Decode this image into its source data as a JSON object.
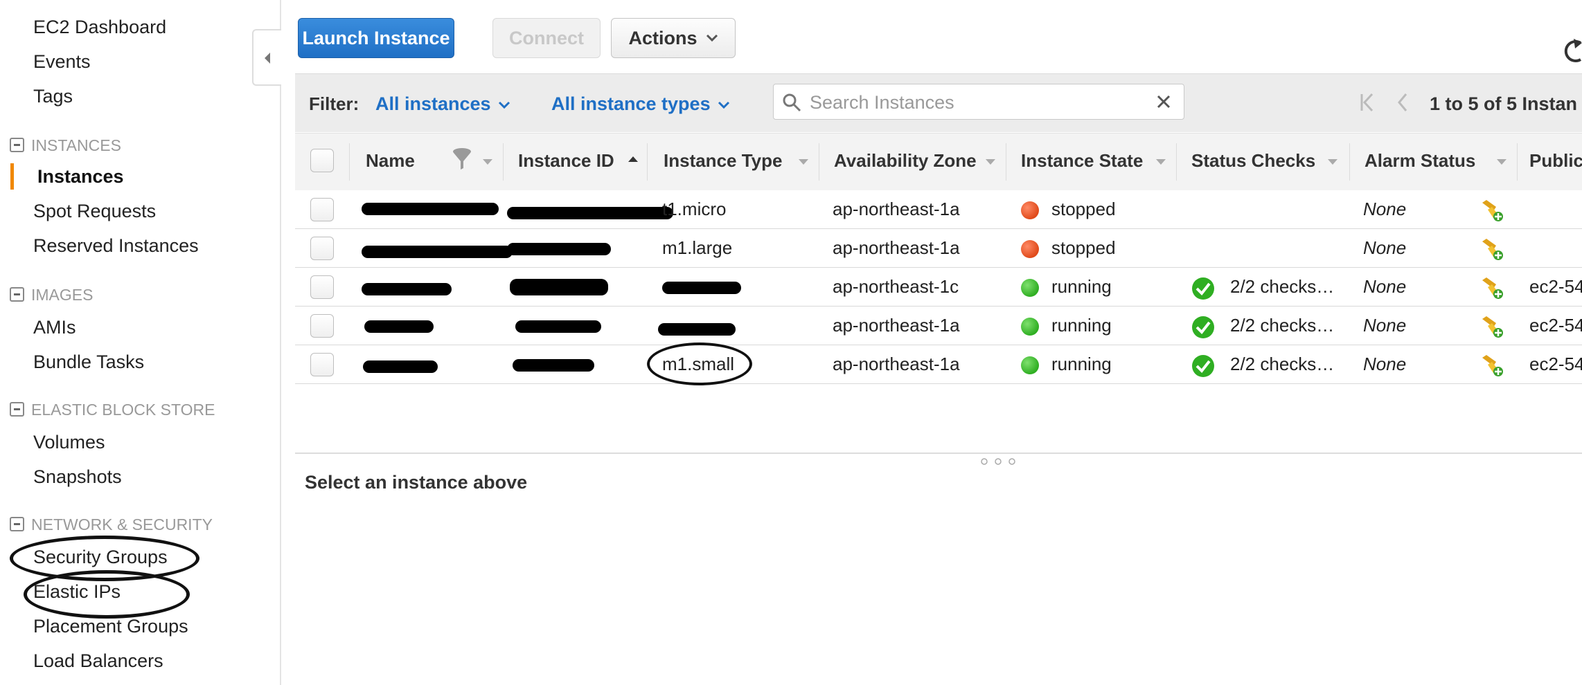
{
  "sidebar": {
    "top_items": [
      {
        "label": "EC2 Dashboard"
      },
      {
        "label": "Events"
      },
      {
        "label": "Tags"
      }
    ],
    "sections": [
      {
        "title": "INSTANCES",
        "items": [
          {
            "label": "Instances",
            "active": true
          },
          {
            "label": "Spot Requests"
          },
          {
            "label": "Reserved Instances"
          }
        ]
      },
      {
        "title": "IMAGES",
        "items": [
          {
            "label": "AMIs"
          },
          {
            "label": "Bundle Tasks"
          }
        ]
      },
      {
        "title": "ELASTIC BLOCK STORE",
        "items": [
          {
            "label": "Volumes"
          },
          {
            "label": "Snapshots"
          }
        ]
      },
      {
        "title": "NETWORK & SECURITY",
        "items": [
          {
            "label": "Security Groups",
            "circled": true
          },
          {
            "label": "Elastic IPs",
            "circled": true
          },
          {
            "label": "Placement Groups"
          },
          {
            "label": "Load Balancers"
          }
        ]
      }
    ],
    "accent_color": "#f08804"
  },
  "toolbar": {
    "launch_label": "Launch Instance",
    "connect_label": "Connect",
    "actions_label": "Actions",
    "primary_color": "#1f6fc5"
  },
  "filter": {
    "label": "Filter:",
    "instances_dropdown": "All instances",
    "types_dropdown": "All instance types",
    "search_placeholder": "Search Instances",
    "pager_text": "1 to 5 of 5 Instan"
  },
  "table": {
    "columns": [
      "Name",
      "Instance ID",
      "Instance Type",
      "Availability Zone",
      "Instance State",
      "Status Checks",
      "Alarm Status",
      "Public"
    ],
    "rows": [
      {
        "name": "",
        "id": "",
        "type": "t1.micro",
        "zone": "ap-northeast-1a",
        "state": "stopped",
        "checks": "",
        "alarm": "None",
        "public": ""
      },
      {
        "name": "",
        "id": "",
        "type": "m1.large",
        "zone": "ap-northeast-1a",
        "state": "stopped",
        "checks": "",
        "alarm": "None",
        "public": ""
      },
      {
        "name": "",
        "id": "",
        "type": "",
        "zone": "ap-northeast-1c",
        "state": "running",
        "checks": "2/2 checks…",
        "alarm": "None",
        "public": "ec2-54"
      },
      {
        "name": "",
        "id": "",
        "type": "",
        "zone": "ap-northeast-1a",
        "state": "running",
        "checks": "2/2 checks…",
        "alarm": "None",
        "public": "ec2-54"
      },
      {
        "name": "",
        "id": "",
        "type": "m1.small",
        "zone": "ap-northeast-1a",
        "state": "running",
        "checks": "2/2 checks…",
        "alarm": "None",
        "public": "ec2-54"
      }
    ],
    "status_colors": {
      "stopped": "#e04a1a",
      "running": "#2fae22"
    }
  },
  "detail": {
    "message": "Select an instance above"
  }
}
